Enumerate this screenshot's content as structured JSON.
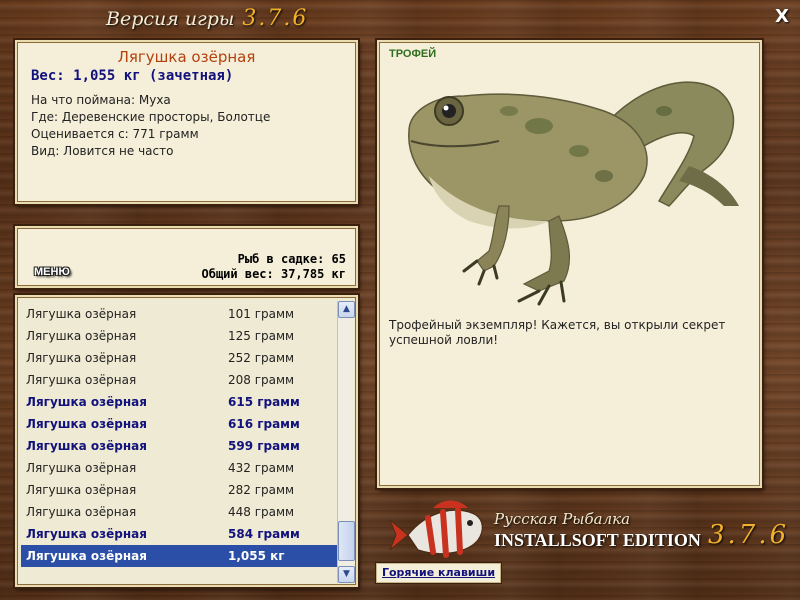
{
  "window": {
    "title_text": "Версия игры",
    "title_version": "3.7.6",
    "close_label": "X"
  },
  "fish": {
    "name": "Лягушка озёрная",
    "weight": "Вес: 1,055 кг (зачетная)",
    "bait": "На что поймана: Муха",
    "location": "Где: Деревенские просторы, Болотце",
    "rated_from": "Оценивается с: 771 грамм",
    "kind": "Вид: Ловится не часто"
  },
  "stats": {
    "fish_in_net": "Рыб в садке: 65",
    "total_weight": "Общий вес: 37,785 кг"
  },
  "menu_label": "МЕНЮ",
  "catch_list": [
    {
      "name": "Лягушка озёрная",
      "weight": "101 грамм",
      "style": "normal"
    },
    {
      "name": "Лягушка озёрная",
      "weight": "125 грамм",
      "style": "normal"
    },
    {
      "name": "Лягушка озёрная",
      "weight": "252 грамм",
      "style": "normal"
    },
    {
      "name": "Лягушка озёрная",
      "weight": "208 грамм",
      "style": "normal"
    },
    {
      "name": "Лягушка озёрная",
      "weight": "615 грамм",
      "style": "trophy"
    },
    {
      "name": "Лягушка озёрная",
      "weight": "616 грамм",
      "style": "trophy"
    },
    {
      "name": "Лягушка озёрная",
      "weight": "599 грамм",
      "style": "trophy"
    },
    {
      "name": "Лягушка озёрная",
      "weight": "432 грамм",
      "style": "normal"
    },
    {
      "name": "Лягушка озёрная",
      "weight": "282 грамм",
      "style": "normal"
    },
    {
      "name": "Лягушка озёрная",
      "weight": "448 грамм",
      "style": "normal"
    },
    {
      "name": "Лягушка озёрная",
      "weight": "584 грамм",
      "style": "trophy"
    },
    {
      "name": "Лягушка озёрная",
      "weight": "1,055 кг",
      "style": "selected"
    }
  ],
  "trophy": {
    "label": "ТРОФЕЙ",
    "description": "Трофейный экземпляр! Кажется, вы открыли секрет успешной ловли!"
  },
  "branding": {
    "line1": "Русская Рыбалка",
    "line2": "INSTALLSOFT EDITION",
    "version": "3.7.6"
  },
  "hotkeys_label": "Горячие клавиши",
  "colors": {
    "accent_orange": "#f2b12b",
    "trophy_text": "#12127d",
    "selected_row": "#2b4fa6",
    "fish_name": "#b3400d"
  }
}
